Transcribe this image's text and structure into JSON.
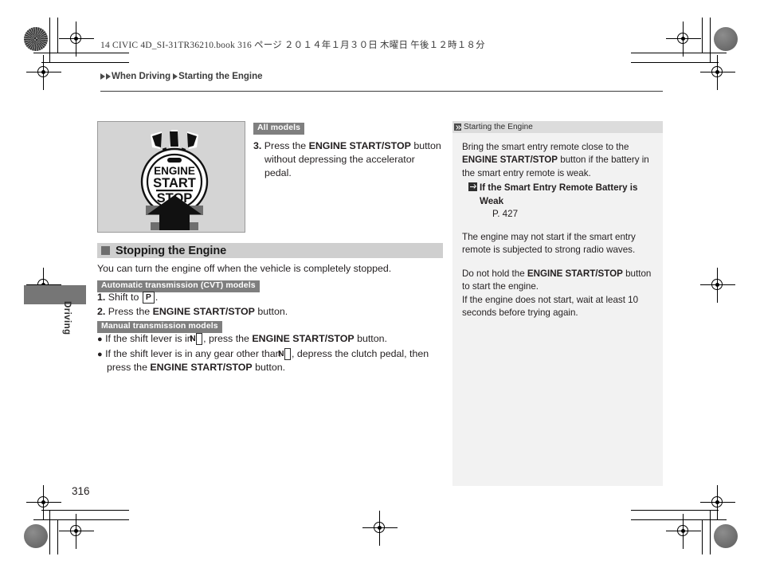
{
  "print_header": "14 CIVIC 4D_SI-31TR36210.book  316 ページ  ２０１４年１月３０日  木曜日  午後１２時１８分",
  "breadcrumb": {
    "items": [
      "When Driving",
      "Starting the Engine"
    ]
  },
  "thumb_tab": {
    "label": "Driving"
  },
  "illustration": {
    "button_line1": "ENGINE",
    "button_line2": "START",
    "button_line3": "STOP"
  },
  "main": {
    "step3": {
      "tag": "All models",
      "number": "3.",
      "text_before": "Press the ",
      "bold": "ENGINE START/STOP",
      "text_after": " button without depressing the accelerator pedal."
    },
    "section": {
      "title": "Stopping the Engine",
      "lead": "You can turn the engine off when the vehicle is completely stopped."
    },
    "automatic": {
      "tag": "Automatic transmission (CVT) models",
      "step1": {
        "number": "1.",
        "text_before": "Shift to ",
        "gear": "P",
        "text_after": "."
      },
      "step2": {
        "number": "2.",
        "text_before": "Press the ",
        "bold": "ENGINE START/STOP",
        "text_after": " button."
      }
    },
    "manual": {
      "tag": "Manual transmission models",
      "bullet1": {
        "text_before": "If the shift lever is in ",
        "gear": "N",
        "text_mid": ", press the ",
        "bold": "ENGINE START/STOP",
        "text_after": " button."
      },
      "bullet2": {
        "text_before": "If the shift lever is in any gear other than ",
        "gear": "N",
        "text_mid": ", depress the clutch pedal, then press the ",
        "bold": "ENGINE START/STOP",
        "text_after": " button."
      }
    }
  },
  "sidebar": {
    "header": "Starting the Engine",
    "para1_before": "Bring the smart entry remote close to the ",
    "para1_bold": "ENGINE START/STOP",
    "para1_after": " button if the battery in the smart entry remote is weak.",
    "reference_title": "If the Smart Entry Remote Battery is Weak",
    "reference_page": "P. 427",
    "para2": "The engine may not start if the smart entry remote is subjected to strong radio waves.",
    "para3_before": "Do not hold the ",
    "para3_bold": "ENGINE START/STOP",
    "para3_after": " button to start the engine.",
    "para4": "If the engine does not start, wait at least 10 seconds before trying again."
  },
  "page_number": "316"
}
